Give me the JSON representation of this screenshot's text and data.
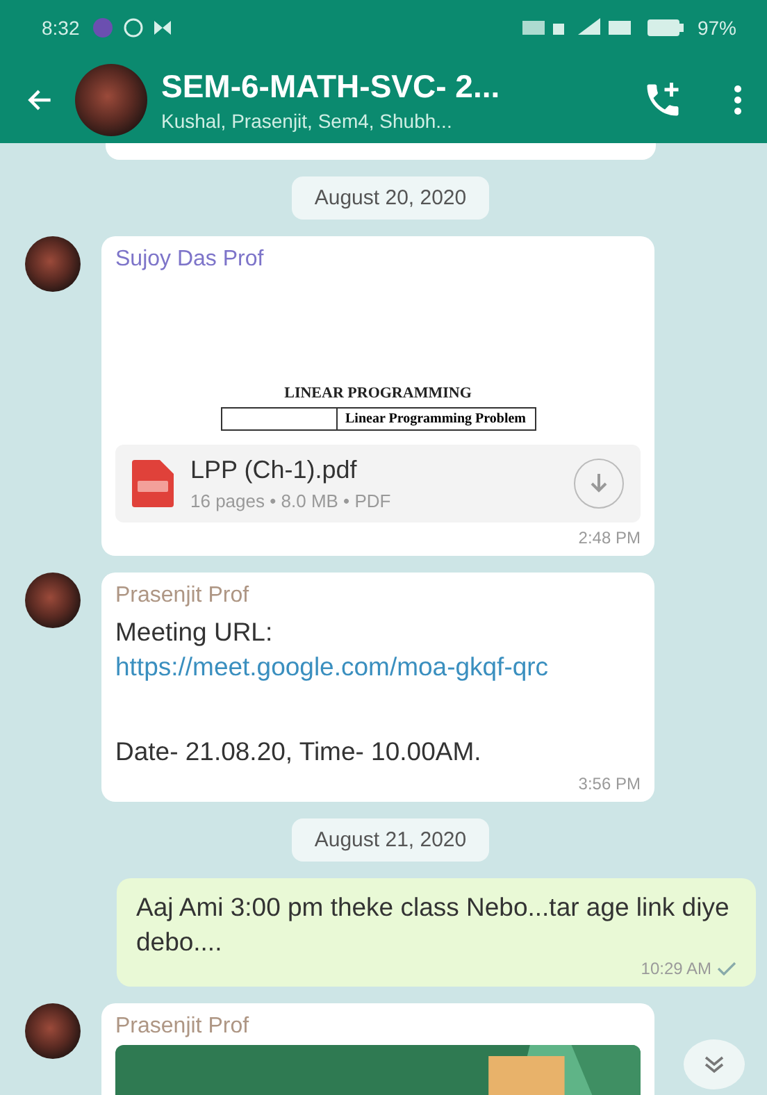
{
  "status_bar": {
    "time": "8:32",
    "battery": "97%"
  },
  "header": {
    "title": "SEM-6-MATH-SVC- 2...",
    "subtitle": "Kushal, Prasenjit, Sem4, Shubh..."
  },
  "messages": [
    {
      "kind": "cut"
    },
    {
      "kind": "date",
      "text": "August 20, 2020"
    },
    {
      "kind": "document",
      "sender": "Sujoy Das Prof",
      "color": "#7d74c9",
      "preview_heading": "LINEAR PROGRAMMING",
      "preview_cell": "Linear Programming Problem",
      "file_name": "LPP (Ch-1).pdf",
      "file_info": "16 pages • 8.0 MB • PDF",
      "time": "2:48 PM"
    },
    {
      "kind": "text",
      "sender": "Prasenjit Prof",
      "color": "#ae9684",
      "prefix": "Meeting URL: ",
      "link": "https://meet.google.com/moa-gkqf-qrc",
      "body": "Date- 21.08.20, Time- 10.00AM.",
      "time": "3:56 PM"
    },
    {
      "kind": "date",
      "text": "August 21, 2020"
    },
    {
      "kind": "outgoing",
      "text": "Aaj Ami 3:00 pm theke class Nebo...tar age link diye debo....",
      "time": "10:29 AM"
    },
    {
      "sender": "Prasenjit Prof",
      "color": "#ae9684"
    }
  ]
}
